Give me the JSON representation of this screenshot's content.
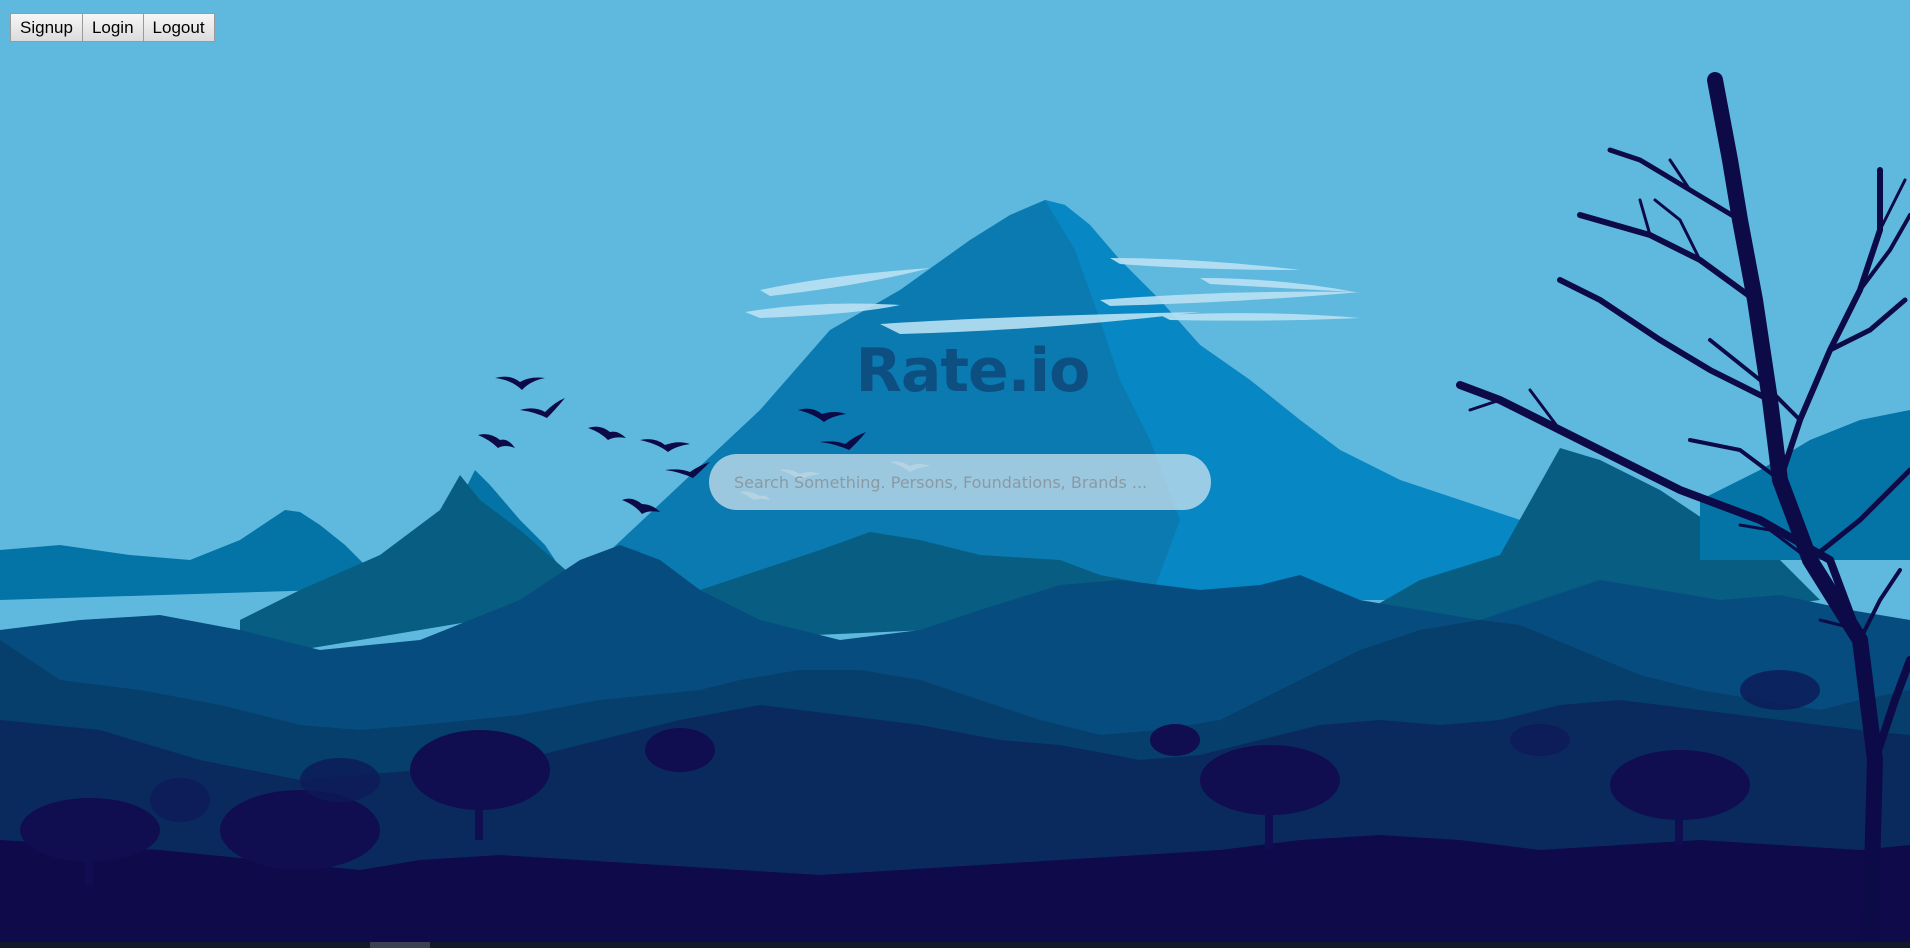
{
  "auth": {
    "signup_label": "Signup",
    "login_label": "Login",
    "logout_label": "Logout"
  },
  "brand": {
    "title": "Rate.io"
  },
  "search": {
    "placeholder": "Search Something. Persons, Foundations, Brands ...",
    "value": ""
  },
  "colors": {
    "sky": "#5fb9de",
    "brand_text": "#0d4f80",
    "foreground": "#0d0a48"
  },
  "background": {
    "icons": [
      "mountain-illustration",
      "bird-flock",
      "bare-tree",
      "cloud-streaks"
    ]
  }
}
